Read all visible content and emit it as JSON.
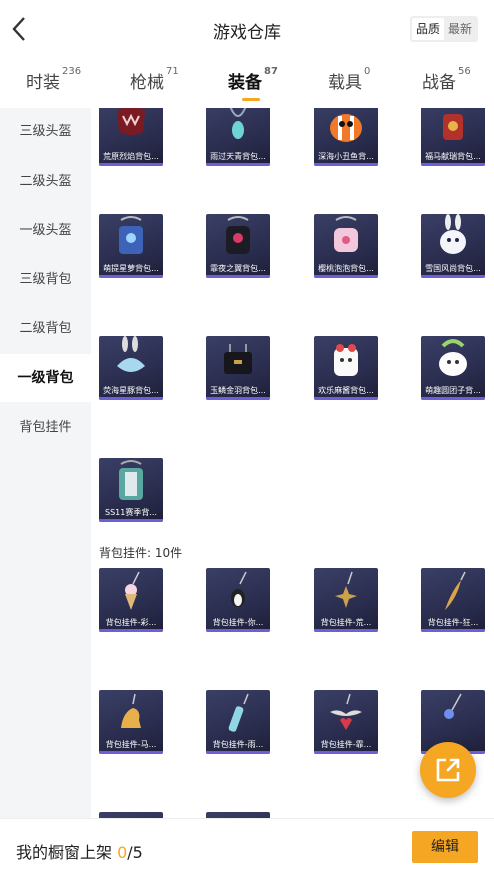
{
  "header": {
    "title": "游戏仓库",
    "sort_options": [
      "品质",
      "最新"
    ],
    "sort_active": 0
  },
  "tabs": [
    {
      "label": "时装",
      "count": "236"
    },
    {
      "label": "枪械",
      "count": "71"
    },
    {
      "label": "装备",
      "count": "87"
    },
    {
      "label": "载具",
      "count": "0"
    },
    {
      "label": "战备",
      "count": "56"
    }
  ],
  "sidebar": {
    "items": [
      "三级头盔",
      "二级头盔",
      "一级头盔",
      "三级背包",
      "二级背包",
      "一级背包",
      "背包挂件"
    ],
    "active": 5
  },
  "backpacks": [
    {
      "label": "荒原烈焰背包...",
      "icon": "red-demon-backpack-icon"
    },
    {
      "label": "雨过天青背包...",
      "icon": "teal-gem-backpack-icon"
    },
    {
      "label": "深海小丑鱼背...",
      "icon": "clownfish-backpack-icon"
    },
    {
      "label": "福马献瑞背包...",
      "icon": "horse-backpack-icon"
    },
    {
      "label": "萌提星萝背包...",
      "icon": "blue-robot-backpack-icon"
    },
    {
      "label": "霏夜之翼背包...",
      "icon": "black-pink-backpack-icon"
    },
    {
      "label": "樱桃泡泡背包...",
      "icon": "pink-bubble-backpack-icon"
    },
    {
      "label": "雪国风尚背包...",
      "icon": "bunny-backpack-icon"
    },
    {
      "label": "荧海星豚背包...",
      "icon": "dolphin-backpack-icon"
    },
    {
      "label": "玉鳞金羽背包...",
      "icon": "black-handbag-icon"
    },
    {
      "label": "欢乐麻酱背包...",
      "icon": "sesame-bunny-backpack-icon"
    },
    {
      "label": "萌趣圆团子背...",
      "icon": "dumpling-backpack-icon"
    },
    {
      "label": "SS11赛季背...",
      "icon": "ss11-backpack-icon"
    }
  ],
  "charms_section": {
    "title": "背包挂件: 10件"
  },
  "charms": [
    {
      "label": "背包挂件-彩...",
      "icon": "icecream-charm-icon"
    },
    {
      "label": "背包挂件-你...",
      "icon": "penguin-charm-icon"
    },
    {
      "label": "背包挂件-荒...",
      "icon": "spiky-charm-icon"
    },
    {
      "label": "背包挂件-狂...",
      "icon": "feather-charm-icon"
    },
    {
      "label": "背包挂件-马...",
      "icon": "horse-charm-icon"
    },
    {
      "label": "背包挂件-雨...",
      "icon": "crystal-charm-icon"
    },
    {
      "label": "背包挂件-霏...",
      "icon": "bat-heart-charm-icon"
    },
    {
      "label": "",
      "icon": "gem-charm-icon"
    },
    {
      "label": "",
      "icon": "charm-icon"
    },
    {
      "label": "",
      "icon": "charm-icon"
    }
  ],
  "bottom": {
    "shelf_prefix": "我的橱窗上架 ",
    "shelf_count": "0",
    "shelf_total": "/5",
    "edit_label": "编辑"
  },
  "colors": {
    "accent": "#f5a623",
    "card_bg": "#2a2d4e",
    "card_bar": "#6f5fd6"
  }
}
